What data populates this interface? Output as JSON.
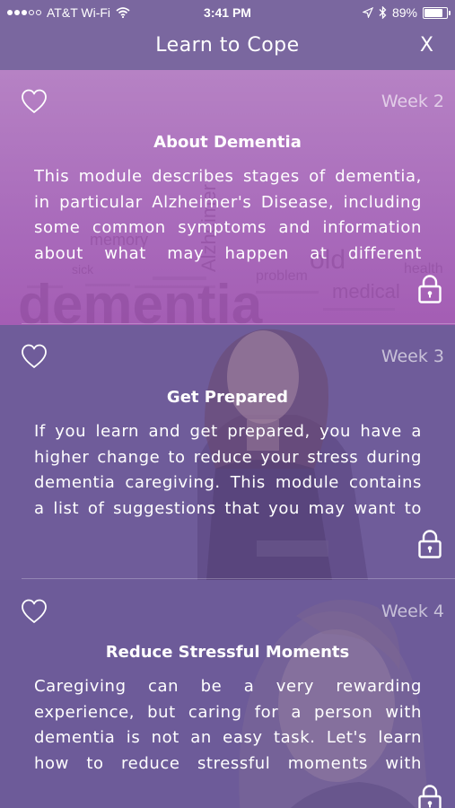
{
  "status_bar": {
    "carrier": "AT&T Wi-Fi",
    "time": "3:41 PM",
    "battery_percent": "89%",
    "battery_level": 0.89
  },
  "nav": {
    "title": "Learn to Cope",
    "close_label": "X"
  },
  "modules": [
    {
      "week": "Week 2",
      "title": "About Dementia",
      "description": "This module describes stages of dementia, in particular Alzheimer's Disease, including some common symptoms and information about what may happen at different period…",
      "favorite_icon": "heart-outline-icon",
      "lock_icon": "lock-icon",
      "background": "dementia word cloud",
      "bg_words": [
        "dementia",
        "Alzheimer",
        "problem",
        "medical",
        "sick",
        "old",
        "health",
        "memory"
      ]
    },
    {
      "week": "Week 3",
      "title": "Get Prepared",
      "description": "If you learn and get prepared, you have a higher change to reduce your stress during dementia caregiving. This module contains a list of suggestions that you may want to con…",
      "favorite_icon": "heart-outline-icon",
      "lock_icon": "lock-icon",
      "background": "woman portrait"
    },
    {
      "week": "Week 4",
      "title": "Reduce Stressful Moments",
      "description": "Caregiving can be a very rewarding experience, but caring for a person with dementia is not an easy task.  Let's learn how to reduce stressful moments with some stra…",
      "favorite_icon": "heart-outline-icon",
      "lock_icon": "lock-icon",
      "background": "stressed woman portrait"
    }
  ],
  "colors": {
    "nav_bg": "#7a679f",
    "card1_bg": "#a96bbb",
    "card2_bg": "#6f5c9a",
    "card3_bg": "#6d5b99",
    "text": "#ffffff",
    "week_text": "#c9bfdc"
  }
}
